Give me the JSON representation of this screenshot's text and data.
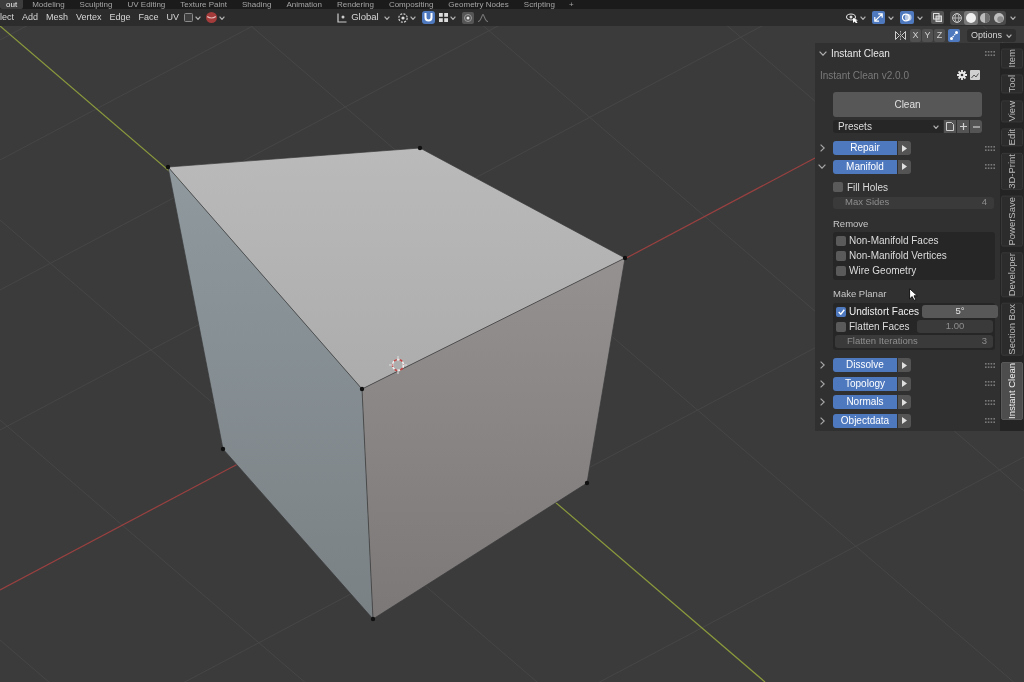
{
  "workspace_tabs": [
    {
      "label": "out",
      "selected": true
    },
    {
      "label": "Modeling",
      "selected": false
    },
    {
      "label": "Sculpting",
      "selected": false
    },
    {
      "label": "UV Editing",
      "selected": false
    },
    {
      "label": "Texture Paint",
      "selected": false
    },
    {
      "label": "Shading",
      "selected": false
    },
    {
      "label": "Animation",
      "selected": false
    },
    {
      "label": "Rendering",
      "selected": false
    },
    {
      "label": "Compositing",
      "selected": false
    },
    {
      "label": "Geometry Nodes",
      "selected": false
    },
    {
      "label": "Scripting",
      "selected": false
    }
  ],
  "add_workspace": "+",
  "header": {
    "menus": [
      "lect",
      "Add",
      "Mesh",
      "Vertex",
      "Edge",
      "Face",
      "UV"
    ],
    "orientation": "Global",
    "snap_on": true,
    "proportional_on": false,
    "gizmos_on": true,
    "overlays_on": true,
    "xray_on": false,
    "shading_modes": [
      {
        "kind": "wireframe",
        "selected": false
      },
      {
        "kind": "solid",
        "selected": true
      },
      {
        "kind": "material",
        "selected": false
      },
      {
        "kind": "rendered",
        "selected": false
      }
    ]
  },
  "mirror_bar": {
    "axes": [
      {
        "label": "X",
        "on": false
      },
      {
        "label": "Y",
        "on": false
      },
      {
        "label": "Z",
        "on": false
      }
    ],
    "toggle_on": true,
    "options": "Options"
  },
  "sidebar": {
    "title": "Instant Clean",
    "expanded": true,
    "version": "Instant Clean v2.0.0",
    "clean_button": "Clean",
    "presets": "Presets",
    "sections": [
      {
        "label": "Repair",
        "expanded": false
      },
      {
        "label": "Manifold",
        "expanded": true,
        "fill_holes": {
          "label": "Fill Holes",
          "checked": false
        },
        "max_sides": {
          "label": "Max Sides",
          "value": "4",
          "disabled": true
        },
        "remove": {
          "title": "Remove",
          "options": [
            {
              "label": "Non-Manifold Faces",
              "checked": false
            },
            {
              "label": "Non-Manifold Vertices",
              "checked": false
            },
            {
              "label": "Wire Geometry",
              "checked": false
            }
          ]
        },
        "make_planar": {
          "title": "Make Planar",
          "rows": [
            {
              "kind": "check",
              "label": "Undistort Faces",
              "checked": true,
              "value": "5°",
              "disabled": false
            },
            {
              "kind": "check",
              "label": "Flatten Faces",
              "checked": false,
              "value": "1.00",
              "disabled": true
            },
            {
              "kind": "field",
              "label": "Flatten Iterations",
              "value": "3",
              "disabled": true
            }
          ]
        }
      },
      {
        "label": "Dissolve",
        "expanded": false
      },
      {
        "label": "Topology",
        "expanded": false
      },
      {
        "label": "Normals",
        "expanded": false
      },
      {
        "label": "Objectdata",
        "expanded": false
      }
    ]
  },
  "sidebar_tabs": [
    {
      "label": "Item",
      "selected": false
    },
    {
      "label": "Tool",
      "selected": false
    },
    {
      "label": "View",
      "selected": false
    },
    {
      "label": "Edit",
      "selected": false
    },
    {
      "label": "3D-Print",
      "selected": false
    },
    {
      "label": "PowerSave",
      "selected": false
    },
    {
      "label": "Developer",
      "selected": false
    },
    {
      "label": "Section Box",
      "selected": false
    },
    {
      "label": "Instant Clean",
      "selected": true
    }
  ]
}
